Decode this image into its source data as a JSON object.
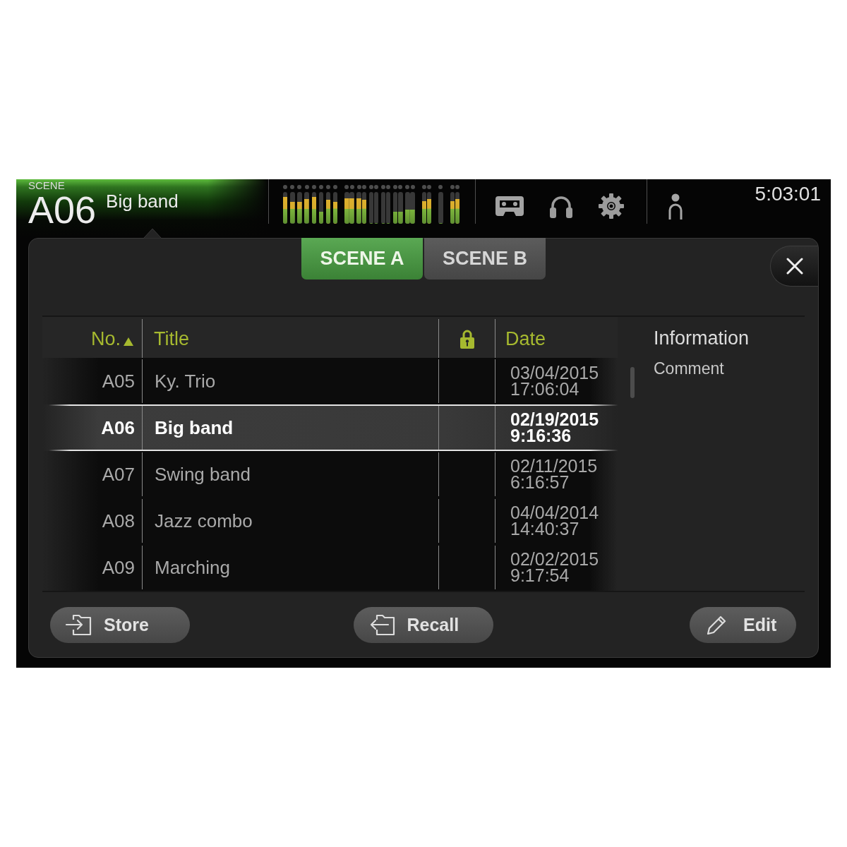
{
  "header": {
    "scene_label": "SCENE",
    "scene_number": "A06",
    "scene_title": "Big band",
    "time": "5:03:01"
  },
  "meter_groups": [
    {
      "channels": [
        {
          "meters": [
            {
              "level": 0.85
            }
          ]
        },
        {
          "meters": [
            {
              "level": 0.68
            }
          ]
        },
        {
          "meters": [
            {
              "level": 0.68
            }
          ]
        },
        {
          "meters": [
            {
              "level": 0.77
            }
          ]
        },
        {
          "meters": [
            {
              "level": 0.85
            }
          ]
        },
        {
          "meters": [
            {
              "level": 0.38
            }
          ]
        },
        {
          "meters": [
            {
              "level": 0.75
            }
          ]
        },
        {
          "meters": [
            {
              "level": 0.68
            }
          ]
        }
      ]
    },
    {
      "channels": [
        {
          "meters": [
            {
              "level": 0.81
            },
            {
              "level": 0.81
            }
          ]
        },
        {
          "meters": [
            {
              "level": 0.81
            },
            {
              "level": 0.75
            }
          ]
        },
        {
          "meters": [
            {
              "level": 0
            },
            {
              "level": 0
            }
          ]
        },
        {
          "meters": [
            {
              "level": 0
            },
            {
              "level": 0
            }
          ]
        },
        {
          "meters": [
            {
              "level": 0.38
            },
            {
              "level": 0.38
            }
          ]
        },
        {
          "meters": [
            {
              "level": 0.45
            },
            {
              "level": 0.45
            }
          ]
        }
      ]
    },
    {
      "channels": [
        {
          "meters": [
            {
              "level": 0.71
            },
            {
              "level": 0.77
            }
          ]
        }
      ]
    },
    {
      "channels": [
        {
          "meters": [
            {
              "level": 0
            }
          ]
        }
      ]
    },
    {
      "channels": [
        {
          "meters": [
            {
              "level": 0.71
            },
            {
              "level": 0.77
            }
          ]
        }
      ]
    }
  ],
  "tabs": [
    {
      "label": "SCENE A",
      "selected": true
    },
    {
      "label": "SCENE B",
      "selected": false
    }
  ],
  "table": {
    "columns": [
      {
        "kind": "number",
        "label": "No.",
        "sorted": true
      },
      {
        "kind": "title",
        "label": "Title",
        "sorted": false
      },
      {
        "kind": "lock",
        "sorted": false
      },
      {
        "kind": "date",
        "label": "Date",
        "sorted": false
      }
    ],
    "rows": [
      {
        "number": "A05",
        "title": "Ky. Trio",
        "date": "03/04/2015",
        "time": "17:06:04",
        "selected": false
      },
      {
        "number": "A06",
        "title": "Big band",
        "date": "02/19/2015",
        "time": "9:16:36",
        "selected": true
      },
      {
        "number": "A07",
        "title": "Swing band",
        "date": "02/11/2015",
        "time": "6:16:57",
        "selected": false
      },
      {
        "number": "A08",
        "title": "Jazz combo",
        "date": "04/04/2014",
        "time": "14:40:37",
        "selected": false
      },
      {
        "number": "A09",
        "title": "Marching",
        "date": "02/02/2015",
        "time": "9:17:54",
        "selected": false
      }
    ]
  },
  "information": {
    "title": "Information",
    "comment_label": "Comment"
  },
  "buttons": [
    {
      "kind": "store",
      "label": "Store"
    },
    {
      "kind": "recall",
      "label": "Recall"
    },
    {
      "kind": "edit",
      "label": "Edit"
    }
  ]
}
